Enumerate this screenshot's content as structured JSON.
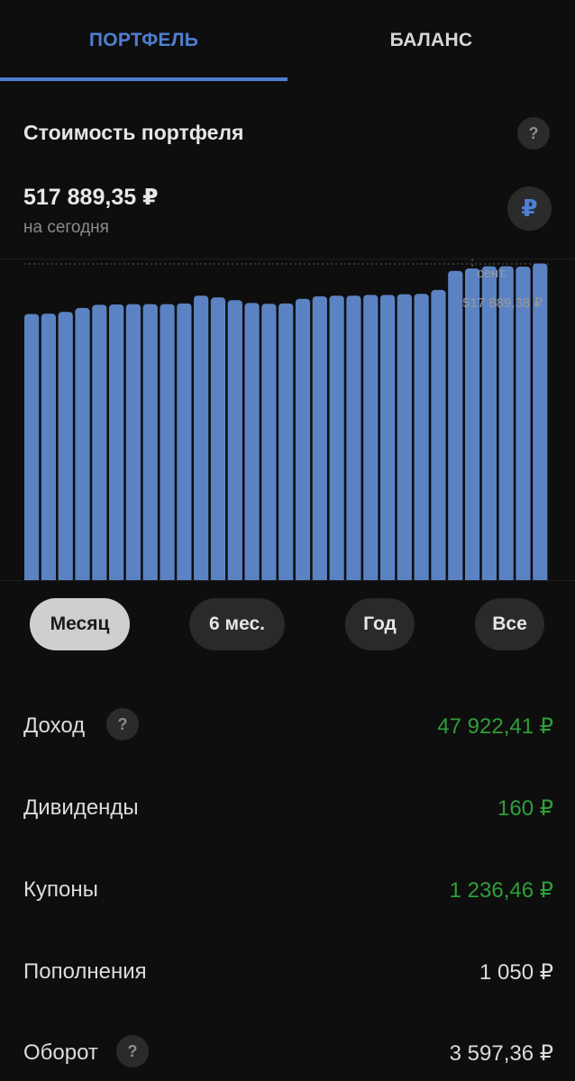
{
  "tabs": [
    {
      "label": "ПОРТФЕЛЬ",
      "active": true
    },
    {
      "label": "БАЛАНС",
      "active": false
    }
  ],
  "portfolio": {
    "title": "Стоимость портфеля",
    "help_icon": "question-mark",
    "value": "517 889,35 ₽",
    "subtitle": "на сегодня",
    "currency_icon": "₽"
  },
  "chart_data": {
    "type": "bar",
    "bar_color": "#5b83c3",
    "values": [
      502650,
      502700,
      502950,
      503500,
      503950,
      504000,
      504050,
      504050,
      504050,
      504150,
      505250,
      505000,
      504600,
      504200,
      504100,
      504150,
      504800,
      505150,
      505250,
      505250,
      505350,
      505350,
      505450,
      505500,
      506050,
      508750,
      509100,
      509400,
      509400,
      509350,
      509800
    ],
    "ylim": [
      465000,
      510500
    ],
    "marker": {
      "label": "сент.",
      "value_label": "517 889,38 ₽",
      "index": 26
    }
  },
  "periods": [
    {
      "label": "Месяц",
      "selected": true
    },
    {
      "label": "6 мес.",
      "selected": false
    },
    {
      "label": "Год",
      "selected": false
    },
    {
      "label": "Все",
      "selected": false
    }
  ],
  "stats": [
    {
      "label": "Доход",
      "value": "47 922,41 ₽",
      "color": "#2f9e3a",
      "help": true
    },
    {
      "label": "Дивиденды",
      "value": "160 ₽",
      "color": "#2f9e3a",
      "help": false
    },
    {
      "label": "Купоны",
      "value": "1 236,46 ₽",
      "color": "#2f9e3a",
      "help": false
    },
    {
      "label": "Пополнения",
      "value": "1 050 ₽",
      "color": "#dcdcdc",
      "help": false
    },
    {
      "label": "Оборот",
      "value": "3 597,36 ₽",
      "color": "#dcdcdc",
      "help": true
    }
  ],
  "help_glyph": "?"
}
